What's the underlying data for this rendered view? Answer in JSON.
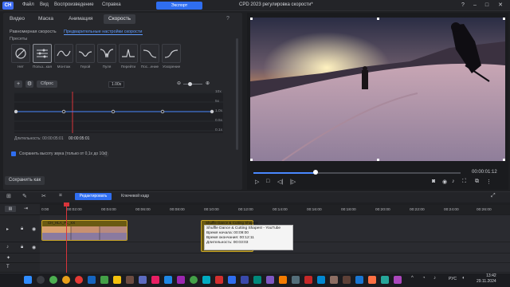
{
  "app": {
    "logo": "CH",
    "title": "CPD 2023 регулировка скорости*",
    "menu": [
      "Файл",
      "Вид",
      "Воспроизведение",
      "Справка"
    ],
    "export_label": "Экспорт"
  },
  "panel": {
    "tabs": [
      "Видео",
      "Маска",
      "Анимация",
      "Скорость"
    ],
    "active_tab": "Скорость",
    "subtabs": [
      "Равномерная скорость",
      "Предварительные настройки скорости"
    ],
    "presets_label": "Пресеты",
    "presets": [
      "Нет",
      "Польз...кая",
      "Монтаж",
      "Герой",
      "Пуля",
      "Перейти",
      "Пос...ение",
      "Ускорение"
    ],
    "reset_label": "Сброс",
    "speed_value": "1.00x",
    "y_labels": [
      "10x",
      "5x",
      "1.0x",
      "0.5x",
      "0.1x"
    ],
    "duration_label": "Длительность: 00:00:05:01",
    "duration_value": "00:00:05:01",
    "keep_pitch_label": "Сохранить высоту звука (только от 0,1x до 10x)",
    "save_label": "Сохранить как"
  },
  "player": {
    "timecode": "00:00:01:12",
    "progress": 0.3
  },
  "timeline": {
    "edit_label": "Редактировать",
    "keyframe_label": "Ключевой кадр",
    "ticks": [
      "0:00",
      "00:02:00",
      "00:04:00",
      "00:06:00",
      "00:08:00",
      "00:10:00",
      "00:12:00",
      "00:14:00",
      "00:16:00",
      "00:18:00",
      "00:20:00",
      "00:22:00",
      "00:24:00",
      "00:26:00"
    ],
    "clip1_label": "CH_HLA_PL_XX",
    "clip2_label": "Shuffle Dance & Cutting Shapes!",
    "tooltip": {
      "title": "Shuffle Dance & Cutting Shapes! - YouTube",
      "start": "Время начала: 00:09:00",
      "end": "Время окончания: 00:12:11",
      "duration": "Длительность: 00:03:03"
    }
  },
  "taskbar": {
    "lang": "РУС",
    "time": "13:42",
    "date": "29.11.2024"
  }
}
